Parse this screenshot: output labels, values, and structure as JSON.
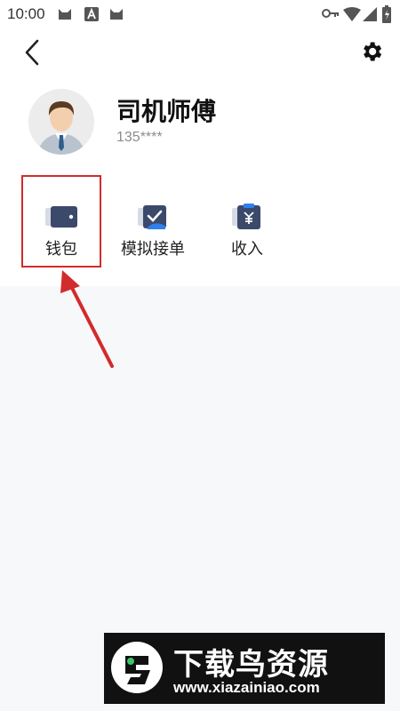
{
  "status_bar": {
    "time": "10:00",
    "left_icons": [
      "cat-icon",
      "a-badge-icon",
      "cat-icon"
    ],
    "right_icons": [
      "key-icon",
      "wifi-icon",
      "signal-icon",
      "battery-icon"
    ]
  },
  "header": {
    "back_icon": "chevron-left-icon",
    "settings_icon": "gear-icon"
  },
  "profile": {
    "name": "司机师傅",
    "phone": "135****",
    "avatar_icon": "avatar-icon"
  },
  "menu": {
    "items": [
      {
        "label": "钱包",
        "icon": "wallet-icon"
      },
      {
        "label": "模拟接单",
        "icon": "clipboard-check-icon"
      },
      {
        "label": "收入",
        "icon": "yen-clipboard-icon"
      }
    ]
  },
  "annotation": {
    "highlight_color": "#d22b2b"
  },
  "watermark": {
    "title": "下载鸟资源",
    "url": "www.xiazainiao.com"
  },
  "colors": {
    "accent_icon": "#3b4a6b",
    "accent_blue": "#2f80ed",
    "background": "#f7f8fa"
  }
}
